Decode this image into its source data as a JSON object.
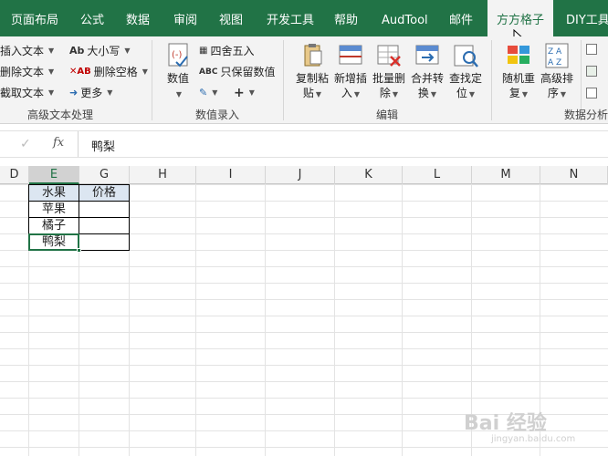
{
  "ribbon_tabs": [
    "页面布局",
    "公式",
    "数据",
    "审阅",
    "视图",
    "开发工具",
    "帮助",
    "AudTool",
    "邮件",
    "方方格子",
    "DIY工具箱"
  ],
  "active_tab": "方方格子",
  "groups": {
    "text": {
      "label": "高级文本处理",
      "items": [
        "插入文本",
        "删除文本",
        "截取文本",
        "大小写",
        "删除空格",
        "更多"
      ]
    },
    "value_entry": {
      "label": "数值录入",
      "items": [
        "数值",
        "四舍五入",
        "只保留数值",
        "+"
      ]
    },
    "edit": {
      "label": "编辑",
      "items": [
        {
          "line1": "复制粘",
          "line2": "贴"
        },
        {
          "line1": "新增插",
          "line2": "入"
        },
        {
          "line1": "批量删",
          "line2": "除"
        },
        {
          "line1": "合并转",
          "line2": "换"
        },
        {
          "line1": "查找定",
          "line2": "位"
        }
      ]
    },
    "analysis": {
      "label": "数据分析",
      "items": [
        {
          "line1": "随机重",
          "line2": "复"
        },
        {
          "line1": "高级排",
          "line2": "序"
        }
      ]
    }
  },
  "formula_bar": {
    "fx": "fx",
    "value": "鸭梨"
  },
  "columns": [
    "D",
    "E",
    "G",
    "H",
    "I",
    "J",
    "K",
    "L",
    "M",
    "N"
  ],
  "selected_column": "E",
  "table": {
    "headers": [
      "水果",
      "价格"
    ],
    "rows": [
      [
        "苹果",
        ""
      ],
      [
        "橘子",
        ""
      ],
      [
        "鸭梨",
        ""
      ]
    ]
  },
  "watermark": {
    "brand": "Bai 经验",
    "url": "jingyan.baidu.com"
  }
}
